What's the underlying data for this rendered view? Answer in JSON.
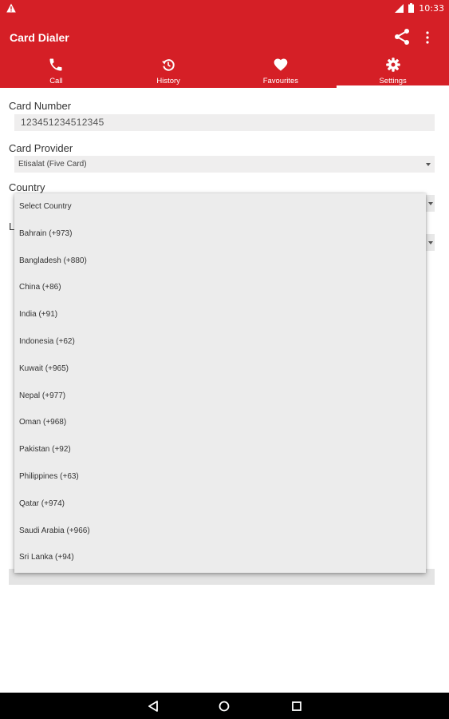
{
  "status_bar": {
    "time": "10:33",
    "icons": [
      "warning-icon",
      "signal-icon",
      "battery-icon"
    ]
  },
  "app_bar": {
    "title": "Card Dialer",
    "actions": [
      "share-icon",
      "more-vert-icon"
    ]
  },
  "tabs": [
    {
      "label": "Call",
      "icon": "phone-icon",
      "active": false
    },
    {
      "label": "History",
      "icon": "history-icon",
      "active": false
    },
    {
      "label": "Favourites",
      "icon": "heart-icon",
      "active": false
    },
    {
      "label": "Settings",
      "icon": "gear-icon",
      "active": true
    }
  ],
  "settings": {
    "card_number_label": "Card Number",
    "card_number_value": "123451234512345",
    "card_provider_label": "Card Provider",
    "card_provider_value": "Etisalat (Five Card)",
    "country_label": "Country",
    "hidden_label_initial": "L"
  },
  "country_dropdown": {
    "options": [
      "Select Country",
      "Bahrain (+973)",
      "Bangladesh (+880)",
      "China (+86)",
      "India (+91)",
      "Indonesia (+62)",
      "Kuwait (+965)",
      "Nepal (+977)",
      "Oman (+968)",
      "Pakistan (+92)",
      "Philippines (+63)",
      "Qatar (+974)",
      "Saudi Arabia (+966)",
      "Sri Lanka (+94)"
    ]
  },
  "nav_bar": {
    "buttons": [
      "back-icon",
      "home-icon",
      "recents-icon"
    ]
  },
  "colors": {
    "primary": "#d51f26",
    "field_background": "#efeeee",
    "dropdown_background": "#ececec"
  }
}
